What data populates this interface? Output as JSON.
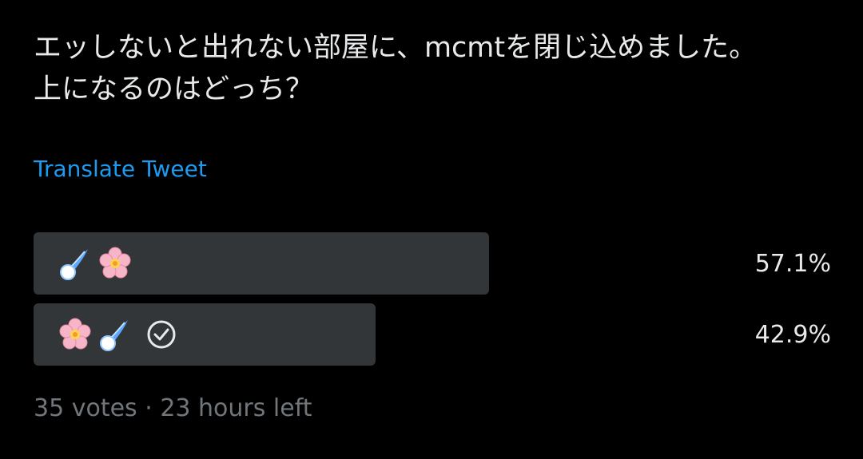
{
  "tweet": {
    "text": "エッしないと出れない部屋に、mcmtを閉じ込めました。\n上になるのはどっち？",
    "translate_label": "Translate Tweet"
  },
  "poll": {
    "options": [
      {
        "label_icons": [
          "comet-icon",
          "cherry-blossom-icon"
        ],
        "percent": "57.1%",
        "value": 57.1,
        "voted": false
      },
      {
        "label_icons": [
          "cherry-blossom-icon",
          "comet-icon"
        ],
        "percent": "42.9%",
        "value": 42.9,
        "voted": true
      }
    ],
    "votes": "35 votes",
    "separator": "·",
    "time_left": "23 hours left"
  },
  "colors": {
    "background": "#000000",
    "text": "#e7e9ea",
    "link": "#1d9bf0",
    "bar": "#333639",
    "muted": "#71767b"
  }
}
